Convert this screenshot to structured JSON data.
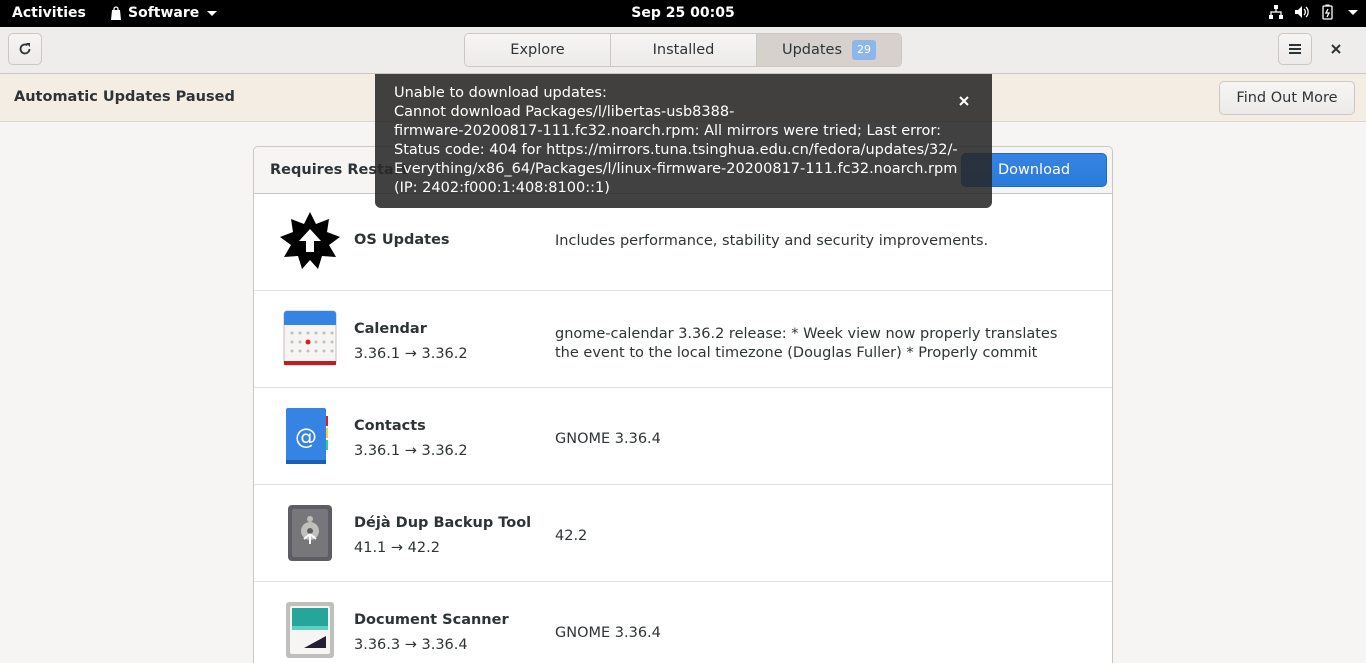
{
  "topbar": {
    "activities": "Activities",
    "app_menu": "Software",
    "clock": "Sep 25  00:05",
    "tray_icons": [
      "network-icon",
      "volume-icon",
      "battery-icon",
      "power-menu-caret"
    ]
  },
  "header": {
    "tabs": [
      {
        "label": "Explore"
      },
      {
        "label": "Installed"
      },
      {
        "label": "Updates",
        "badge": "29"
      }
    ]
  },
  "infobar": {
    "title": "Automatic Updates Paused",
    "button": "Find Out More"
  },
  "notification": {
    "lines": [
      "Unable to download updates:",
      "Cannot download Packages/l/libertas-usb8388-",
      "firmware-20200817-111.fc32.noarch.rpm: All mirrors were tried; Last error:",
      "Status code: 404 for https://mirrors.tuna.tsinghua.edu.cn/fedora/updates/32/-",
      "Everything/x86_64/Packages/l/linux-firmware-20200817-111.fc32.noarch.rpm",
      "(IP: 2402:f000:1:408:8100::1)"
    ]
  },
  "updates": {
    "section_title": "Requires Restart",
    "download_label": "Download",
    "items": [
      {
        "name": "OS Updates",
        "version": "",
        "desc": "Includes performance, stability and security improvements."
      },
      {
        "name": "Calendar",
        "version": "3.36.1 → 3.36.2",
        "desc": "gnome-calendar 3.36.2 release: * Week view now properly translates the event to the local timezone (Douglas Fuller) * Properly commit sequence after event c…"
      },
      {
        "name": "Contacts",
        "version": "3.36.1 → 3.36.2",
        "desc": "GNOME 3.36.4"
      },
      {
        "name": "Déjà Dup Backup Tool",
        "version": "41.1 → 42.2",
        "desc": "42.2"
      },
      {
        "name": "Document Scanner",
        "version": "3.36.3 → 3.36.4",
        "desc": "GNOME 3.36.4"
      }
    ]
  },
  "colors": {
    "accent": "#3584e4",
    "badge": "#8fb6e8",
    "topbar": "#000000"
  }
}
